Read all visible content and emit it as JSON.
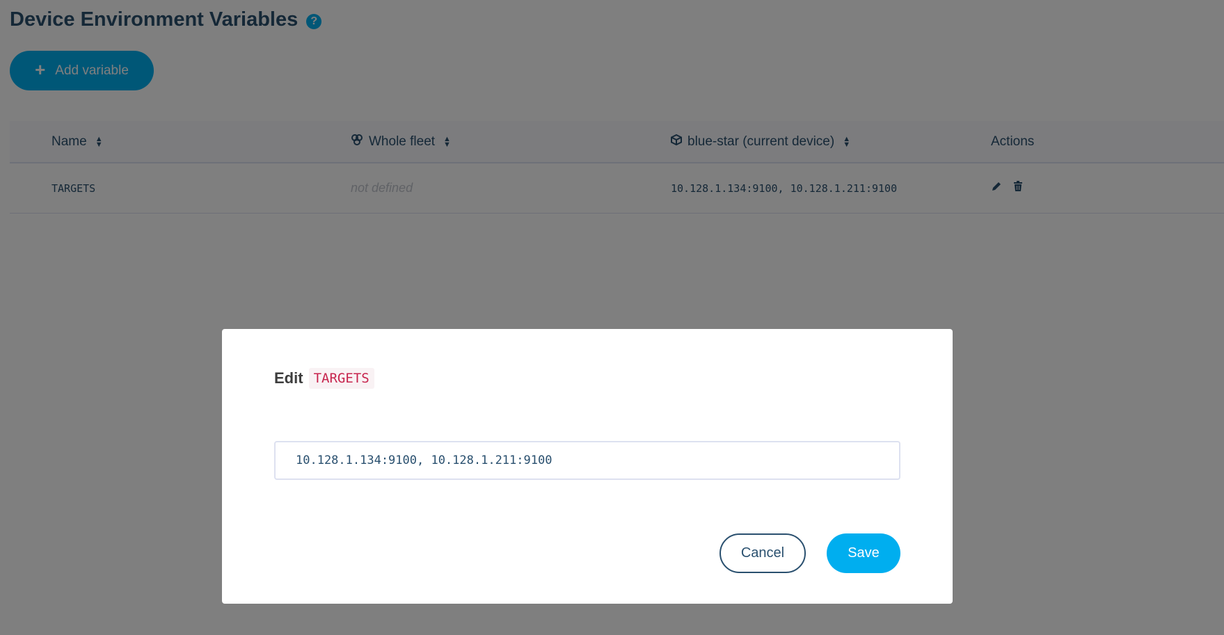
{
  "page": {
    "title": "Device Environment Variables",
    "help_icon": "question-circle-icon"
  },
  "toolbar": {
    "add_label": "Add variable",
    "add_icon": "plus-icon"
  },
  "table": {
    "headers": {
      "name": "Name",
      "fleet": "Whole fleet",
      "device": "blue-star (current device)",
      "actions": "Actions"
    },
    "rows": [
      {
        "name": "TARGETS",
        "fleet_value": "not defined",
        "device_value": "10.128.1.134:9100, 10.128.1.211:9100"
      }
    ]
  },
  "modal": {
    "title_prefix": "Edit",
    "variable_name": "TARGETS",
    "input_value": "10.128.1.134:9100, 10.128.1.211:9100",
    "cancel_label": "Cancel",
    "save_label": "Save"
  },
  "colors": {
    "accent": "#00aeef",
    "text": "#2a506f",
    "overlay": "rgba(0,0,0,0.5)",
    "code_text": "#c7254e"
  }
}
